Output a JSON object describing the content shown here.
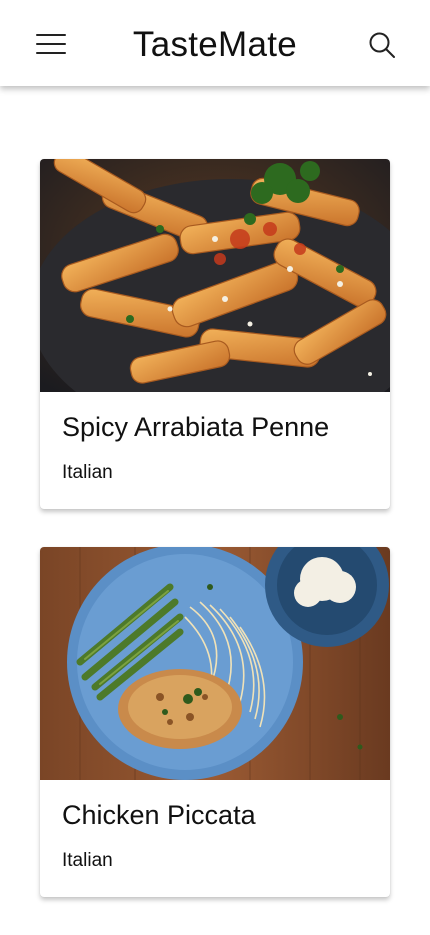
{
  "header": {
    "title": "TasteMate",
    "menu_icon": "menu-icon",
    "search_icon": "search-icon"
  },
  "recipes": [
    {
      "title": "Spicy Arrabiata Penne",
      "cuisine": "Italian",
      "image": "pasta-photo"
    },
    {
      "title": "Chicken Piccata",
      "cuisine": "Italian",
      "image": "chicken-piccata-photo"
    }
  ]
}
